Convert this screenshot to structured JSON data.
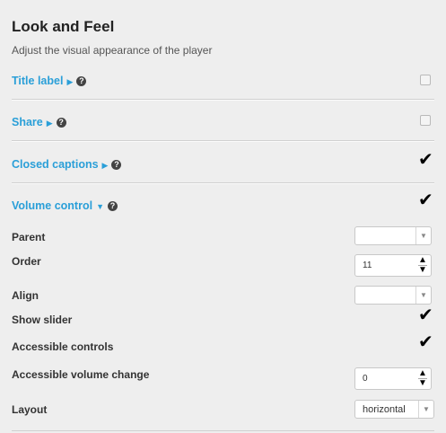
{
  "panel": {
    "title": "Look and Feel",
    "subtitle": "Adjust the visual appearance of the player"
  },
  "sections": {
    "title_label": {
      "label": "Title label",
      "arrow": "▶",
      "help": "?",
      "checked": false
    },
    "share": {
      "label": "Share",
      "arrow": "▶",
      "help": "?",
      "checked": false
    },
    "closed_captions": {
      "label": "Closed captions",
      "arrow": "▶",
      "help": "?",
      "checked": true
    },
    "volume_control": {
      "label": "Volume control",
      "arrow": "▼",
      "help": "?",
      "checked": true
    }
  },
  "volume_fields": {
    "parent": {
      "label": "Parent",
      "value": ""
    },
    "order": {
      "label": "Order",
      "value": "11"
    },
    "align": {
      "label": "Align",
      "value": ""
    },
    "show_slider": {
      "label": "Show slider",
      "checked": true
    },
    "accessible_controls": {
      "label": "Accessible controls",
      "checked": true
    },
    "accessible_volume_change": {
      "label": "Accessible volume change",
      "value": "0"
    },
    "layout": {
      "label": "Layout",
      "value": "horizontal"
    }
  },
  "glyphs": {
    "check": "✔",
    "spin_up": "▲",
    "spin_down": "▼",
    "select_arrow": "▼"
  },
  "colors": {
    "link": "#2a9fd8",
    "background": "#eeeeee"
  }
}
